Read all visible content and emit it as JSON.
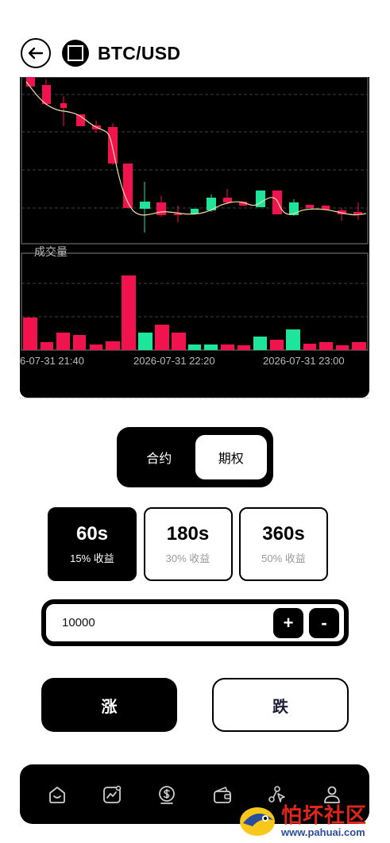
{
  "header": {
    "pair": "BTC/USD",
    "back_icon": "arrow-left-icon",
    "coin_icon": "coin-logo-icon"
  },
  "chart_data": {
    "type": "candlestick",
    "volume_label": "成交量",
    "x_ticks": [
      "6-07-31 21:40",
      "2026-07-31 22:20",
      "2026-07-31 23:00"
    ],
    "candles": [
      {
        "dir": "down"
      },
      {
        "dir": "down"
      },
      {
        "dir": "down"
      },
      {
        "dir": "down"
      },
      {
        "dir": "down"
      },
      {
        "dir": "down"
      },
      {
        "dir": "down"
      },
      {
        "dir": "up"
      },
      {
        "dir": "down"
      },
      {
        "dir": "up"
      },
      {
        "dir": "up"
      },
      {
        "dir": "down"
      },
      {
        "dir": "up"
      },
      {
        "dir": "down"
      },
      {
        "dir": "up"
      },
      {
        "dir": "down"
      },
      {
        "dir": "down"
      },
      {
        "dir": "up"
      },
      {
        "dir": "down"
      },
      {
        "dir": "down"
      },
      {
        "dir": "down"
      }
    ],
    "colors": {
      "up": "#1fe59a",
      "down": "#f0134d",
      "ma": "#f5dd9e"
    }
  },
  "tabs": {
    "contract": "合约",
    "option": "期权",
    "active": "option"
  },
  "durations": [
    {
      "time": "60s",
      "yield": "15% 收益",
      "active": true
    },
    {
      "time": "180s",
      "yield": "30% 收益",
      "active": false
    },
    {
      "time": "360s",
      "yield": "50% 收益",
      "active": false
    }
  ],
  "amount": {
    "value": "10000",
    "plus": "+",
    "minus": "-"
  },
  "actions": {
    "rise": "涨",
    "fall": "跌"
  },
  "nav": [
    "home-icon",
    "market-chart-icon",
    "dollar-coin-icon",
    "wallet-icon",
    "share-icon",
    "profile-icon"
  ],
  "watermark": {
    "text": "怕坏社区",
    "url": "www.pahuai.com"
  }
}
